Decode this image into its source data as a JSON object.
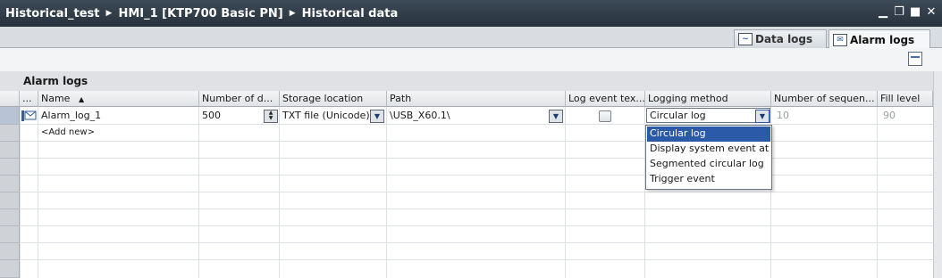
{
  "titlebar": {
    "crumbs": [
      "Historical_test",
      "HMI_1 [KTP700 Basic PN]",
      "Historical data"
    ],
    "separator": "▶"
  },
  "tabs": [
    {
      "label": "Data logs",
      "icon": "data-log-icon",
      "active": false
    },
    {
      "label": "Alarm logs",
      "icon": "alarm-log-icon",
      "active": true
    }
  ],
  "grid": {
    "title": "Alarm logs",
    "columns": {
      "dots": "...",
      "name": "Name",
      "number": "Number of d...",
      "storage": "Storage location",
      "path": "Path",
      "log_event": "Log event tex...",
      "logging_method": "Logging method",
      "number_seq": "Number of sequen...",
      "fill_level": "Fill level"
    },
    "sort_glyph": "▲",
    "row": {
      "name": "Alarm_log_1",
      "number": "500",
      "storage": "TXT file (Unicode)",
      "path": "\\USB_X60.1\\",
      "logging_method": "Circular log",
      "number_seq": "10",
      "fill_level": "90"
    },
    "add_new": "<Add new>"
  },
  "dropdown": {
    "options": [
      "Circular log",
      "Display system event at",
      "Segmented circular log",
      "Trigger event"
    ],
    "selected": "Circular log"
  },
  "colors": {
    "titlebar": "#2f3b47",
    "selection": "#2b5aa8",
    "row_header": "#cfd3d8"
  }
}
